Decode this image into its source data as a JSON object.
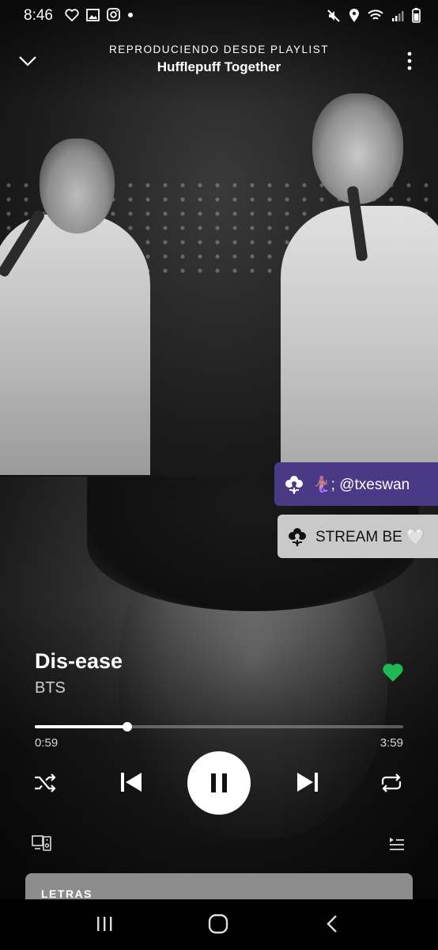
{
  "status_bar": {
    "time": "8:46",
    "left_icons": [
      "heart-outline-icon",
      "gallery-icon",
      "instagram-icon",
      "dot-icon"
    ],
    "right_icons": [
      "mute-icon",
      "location-icon",
      "wifi-icon",
      "signal-icon",
      "battery-icon"
    ]
  },
  "header": {
    "subtitle": "REPRODUCIENDO DESDE PLAYLIST",
    "title": "Hufflepuff Together"
  },
  "stickers": [
    {
      "text": "🧜🏽‍♀️; @txeswan",
      "icon": "flower-icon"
    },
    {
      "text": "STREAM BE 🤍",
      "icon": "flower-icon"
    }
  ],
  "track": {
    "title": "Dis-ease",
    "artist": "BTS",
    "liked": true
  },
  "progress": {
    "elapsed": "0:59",
    "total": "3:59",
    "fraction": 0.25
  },
  "lyrics": {
    "label": "LETRAS"
  },
  "colors": {
    "accent_green": "#1db954",
    "sticker_purple": "#4a3a85",
    "sticker_grey": "#c9c9c9",
    "lyrics_card": "#8c8c8c"
  }
}
